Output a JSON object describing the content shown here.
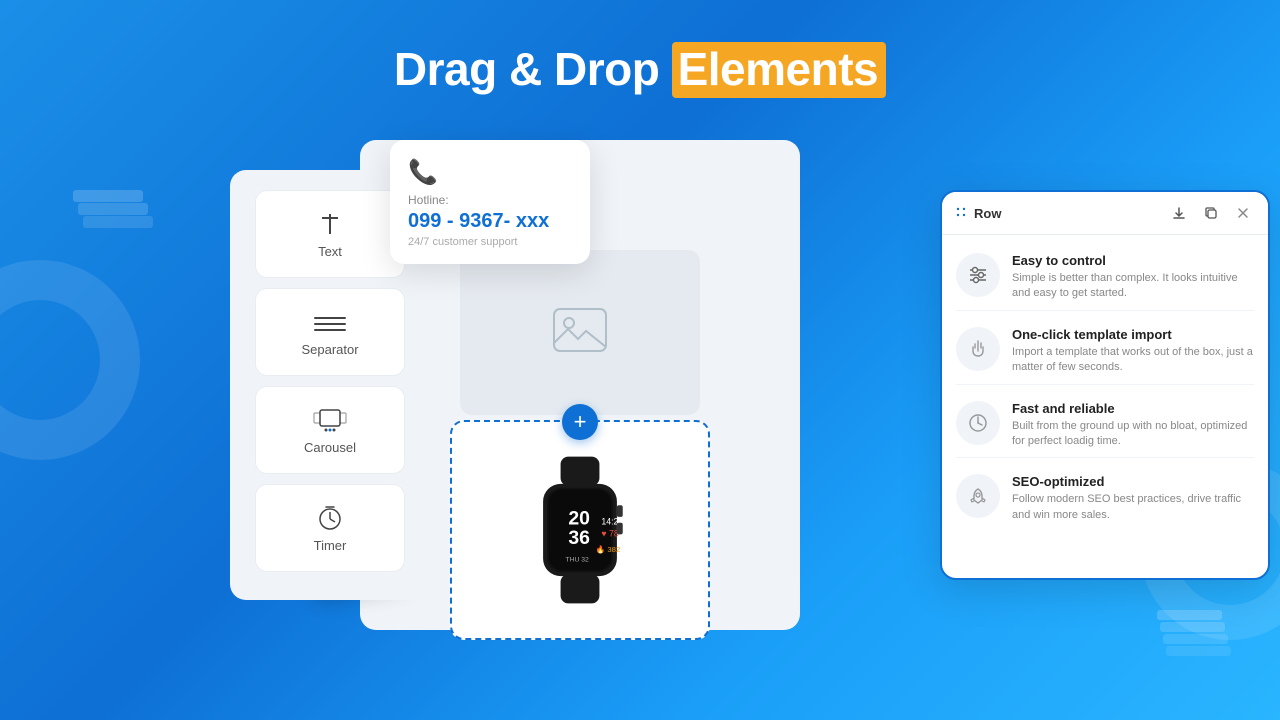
{
  "page": {
    "title": "Drag & Drop Elements",
    "title_highlight": "Elements",
    "background_gradient": "linear-gradient(135deg, #1a8fe8, #0e6fd4, #2ab5ff)"
  },
  "header": {
    "title_part1": "Drag & Drop ",
    "title_highlight": "Elements"
  },
  "hotline_card": {
    "label": "Hotline:",
    "number": "099 - 9367- xxx",
    "support": "24/7 customer support"
  },
  "sidebar": {
    "items": [
      {
        "id": "text",
        "label": "Text",
        "icon": "text-icon"
      },
      {
        "id": "separator",
        "label": "Separator",
        "icon": "separator-icon"
      },
      {
        "id": "carousel",
        "label": "Carousel",
        "icon": "carousel-icon"
      },
      {
        "id": "timer",
        "label": "Timer",
        "icon": "timer-icon"
      }
    ]
  },
  "product_btn": {
    "label": "+"
  },
  "image_element": {
    "label": "Image"
  },
  "row_toolbar": {
    "label": "Row",
    "download_title": "Download",
    "copy_title": "Copy",
    "close_title": "Close"
  },
  "features": [
    {
      "id": "easy-control",
      "title": "Easy to control",
      "desc": "Simple is better than complex. It looks intuitive and easy to get started.",
      "icon": "sliders-icon"
    },
    {
      "id": "one-click-import",
      "title": "One-click template import",
      "desc": "Import a template that works out of the box, just a matter of few seconds.",
      "icon": "hand-icon"
    },
    {
      "id": "fast-reliable",
      "title": "Fast and reliable",
      "desc": "Built from the ground up with no bloat, optimized for perfect loadig time.",
      "icon": "clock-icon"
    },
    {
      "id": "seo-optimized",
      "title": "SEO-optimized",
      "desc": "Follow modern SEO best practices, drive traffic and win more sales.",
      "icon": "rocket-icon"
    }
  ]
}
